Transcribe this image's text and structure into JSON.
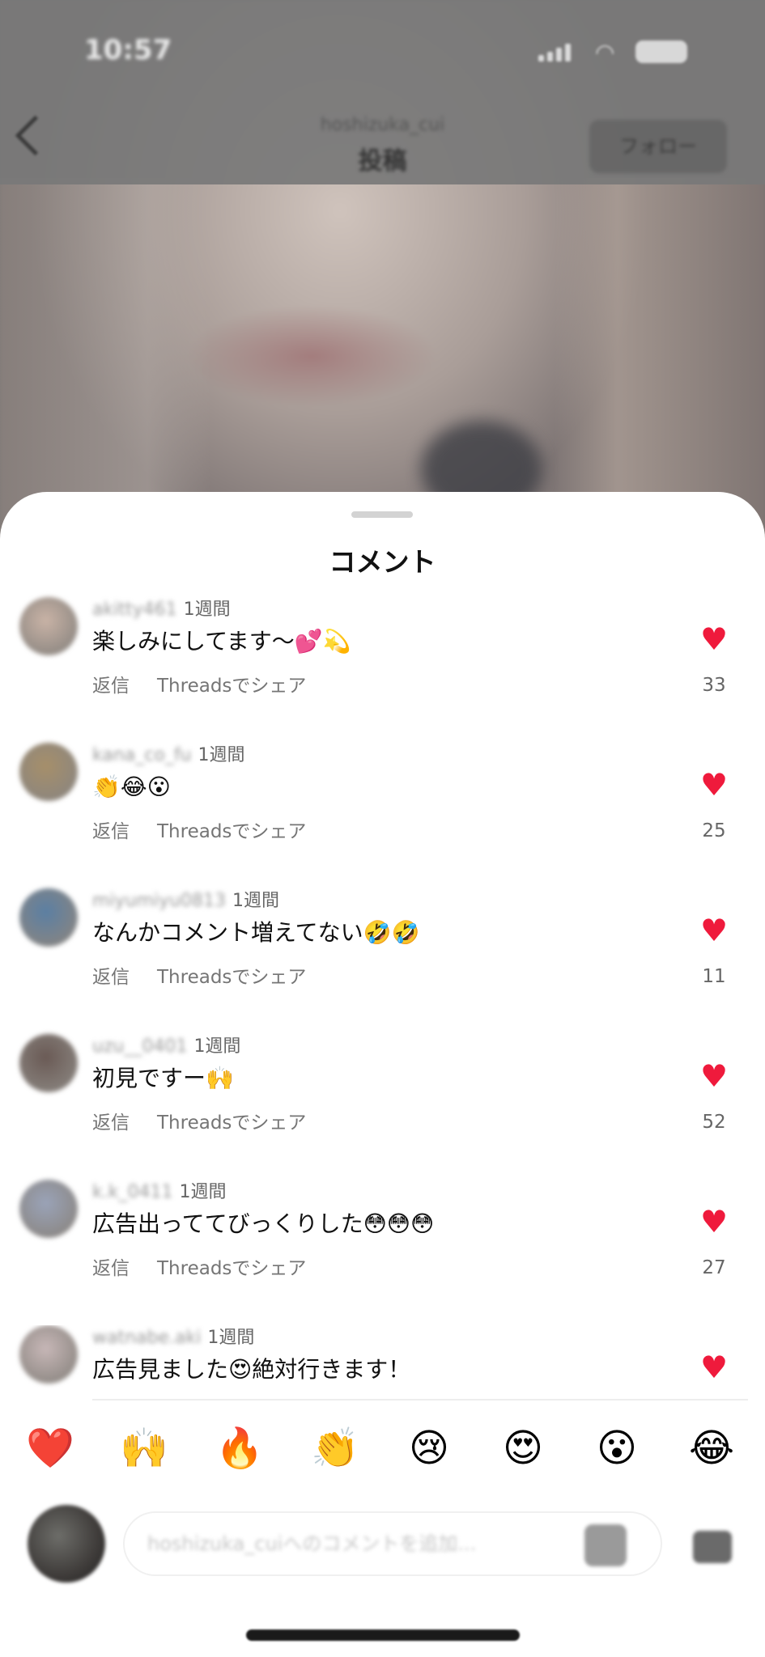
{
  "status_bar": {
    "time": "10:57"
  },
  "nav": {
    "subtitle": "hoshizuka_cui",
    "title": "投稿",
    "follow_label": "フォロー"
  },
  "sheet": {
    "title": "コメント"
  },
  "comments": [
    {
      "username": "akitty461",
      "time": "1週間",
      "text": "楽しみにしてます〜💕💫",
      "reply_label": "返信",
      "share_label": "Threadsでシェア",
      "likes": "33",
      "avatar_color": "#c9b3a6"
    },
    {
      "username": "kana_co_fu",
      "time": "1週間",
      "text": "👏😂😮",
      "reply_label": "返信",
      "share_label": "Threadsでシェア",
      "likes": "25",
      "avatar_color": "#a68f6a"
    },
    {
      "username": "miyumiyu0813",
      "time": "1週間",
      "text": "なんかコメント増えてない🤣🤣",
      "reply_label": "返信",
      "share_label": "Threadsでシェア",
      "likes": "11",
      "avatar_color": "#5b7fa3"
    },
    {
      "username": "uzu__0401",
      "time": "1週間",
      "text": "初見ですー🙌",
      "reply_label": "返信",
      "share_label": "Threadsでシェア",
      "likes": "52",
      "avatar_color": "#6a5a55"
    },
    {
      "username": "k.k_0411",
      "time": "1週間",
      "text": "広告出っててびっくりした😳😳😳",
      "reply_label": "返信",
      "share_label": "Threadsでシェア",
      "likes": "27",
      "avatar_color": "#9aa3b8"
    },
    {
      "username": "watnabe.aki",
      "time": "1週間",
      "text": "広告見ました😍絶対行きます！",
      "avatar_color": "#c7b7b7"
    }
  ],
  "reactions": [
    "❤️",
    "🙌",
    "🔥",
    "👏",
    "😢",
    "😍",
    "😮",
    "😂"
  ],
  "input": {
    "placeholder": "hoshizuka_cuiへのコメントを追加..."
  },
  "colors": {
    "like_red": "#ef1a3c",
    "sheet_bg": "#ffffff"
  }
}
